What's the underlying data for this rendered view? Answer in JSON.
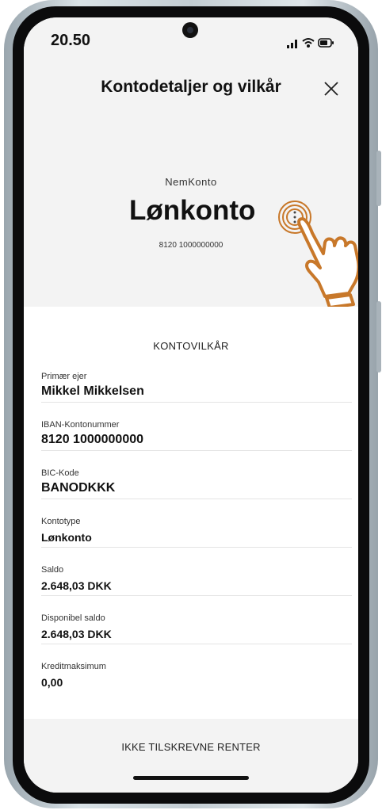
{
  "status_bar": {
    "time": "20.50"
  },
  "header": {
    "title": "Kontodetaljer og vilkår"
  },
  "account": {
    "type": "NemKonto",
    "name": "Lønkonto",
    "number": "8120 1000000000"
  },
  "terms": {
    "title": "KONTOVILKÅR",
    "rows": [
      {
        "label": "Primær ejer",
        "value": "Mikkel Mikkelsen"
      },
      {
        "label": "IBAN-Kontonummer",
        "value": "8120 1000000000"
      },
      {
        "label": "BIC-Kode",
        "value": "BANODKKK"
      },
      {
        "label": "Kontotype",
        "value": "Lønkonto"
      },
      {
        "label": "Saldo",
        "value": "2.648,03 DKK"
      },
      {
        "label": "Disponibel saldo",
        "value": "2.648,03 DKK"
      },
      {
        "label": "Kreditmaksimum",
        "value": "0,00"
      }
    ]
  },
  "bottom": {
    "section_title": "IKKE TILSKREVNE RENTER"
  },
  "colors": {
    "accent_hand": "#c8782a",
    "background_gray": "#f3f3f3"
  },
  "icons": [
    "camera-icon",
    "signal-icon",
    "wifi-icon",
    "battery-icon",
    "close-icon",
    "more-vertical-icon",
    "pointing-hand-icon"
  ]
}
